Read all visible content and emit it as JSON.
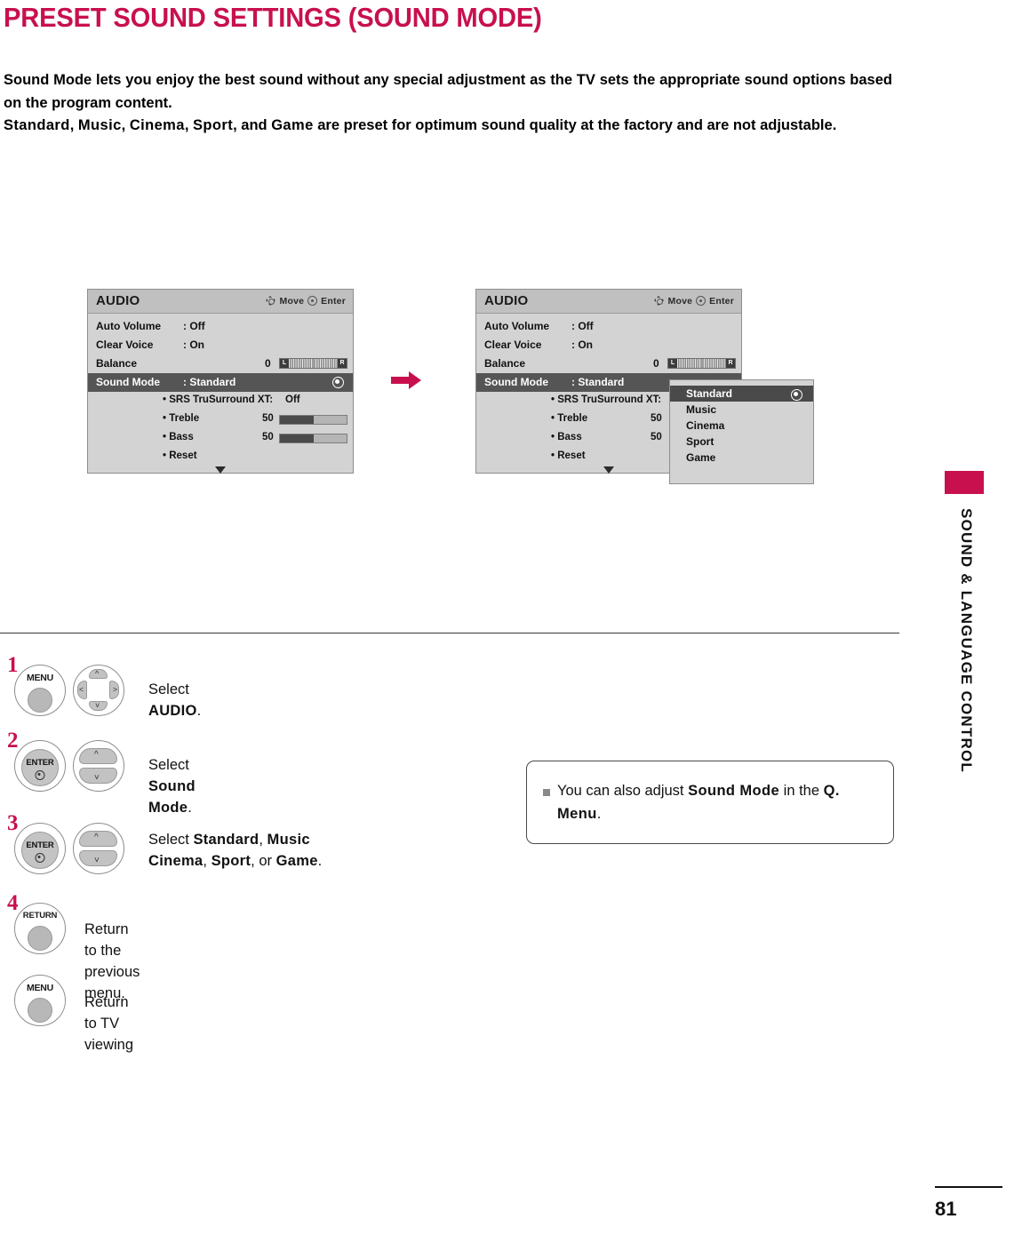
{
  "page": {
    "title": "PRESET SOUND SETTINGS (SOUND MODE)",
    "accent_color": "#C8104E",
    "number": "81",
    "side_label": "SOUND & LANGUAGE CONTROL"
  },
  "intro": {
    "para1": "Sound Mode lets you enjoy the best sound without any special adjustment as the TV sets the appropriate sound options based on the program content.",
    "line2_modes": [
      "Standard",
      "Music",
      "Cinema",
      "Sport",
      "Game"
    ],
    "line2_sep1": ", ",
    "line2_and": ", and ",
    "line2_tail": " are preset for optimum sound quality at the factory and are not adjustable."
  },
  "osd": {
    "title": "AUDIO",
    "hint_move": "Move",
    "hint_enter": "Enter",
    "rows": [
      {
        "label": "Auto Volume",
        "value": ": Off"
      },
      {
        "label": "Clear Voice",
        "value": ": On"
      },
      {
        "label": "Balance",
        "value": "0",
        "bar_left": "L",
        "bar_right": "R"
      },
      {
        "label": "Sound Mode",
        "value": ": Standard"
      }
    ],
    "sub_rows": [
      {
        "label": "• SRS TruSurround XT:",
        "value": "Off"
      },
      {
        "label": "• Treble",
        "value": "50",
        "fill_pct": 50
      },
      {
        "label": "• Bass",
        "value": "50",
        "fill_pct": 50
      },
      {
        "label": "• Reset",
        "value": ""
      }
    ]
  },
  "dropdown": {
    "items": [
      "Standard",
      "Music",
      "Cinema",
      "Sport",
      "Game"
    ],
    "selected_index": 0
  },
  "steps": [
    {
      "num": "1",
      "button": "MENU",
      "pad": "fourway",
      "text_prefix": "Select ",
      "text_bold": "AUDIO",
      "text_suffix": "."
    },
    {
      "num": "2",
      "button": "ENTER",
      "pad": "updown",
      "text_prefix": "Select ",
      "text_bold": "Sound Mode",
      "text_suffix": "."
    },
    {
      "num": "3",
      "button": "ENTER",
      "pad": "updown",
      "text_prefix": "Select ",
      "text_bold_list": [
        "Standard",
        "Music",
        "Cinema",
        "Sport",
        "Game"
      ],
      "text_or": ", or ",
      "text_suffix": "."
    },
    {
      "num": "4",
      "button": "RETURN",
      "pad": "none",
      "text_plain": "Return to the previous menu."
    },
    {
      "num": "",
      "button": "MENU",
      "pad": "none",
      "text_plain": "Return to TV viewing"
    }
  ],
  "note": {
    "prefix": "You can also adjust ",
    "bold1": "Sound Mode",
    "mid": " in the ",
    "bold2": "Q. Menu",
    "suffix": "."
  }
}
